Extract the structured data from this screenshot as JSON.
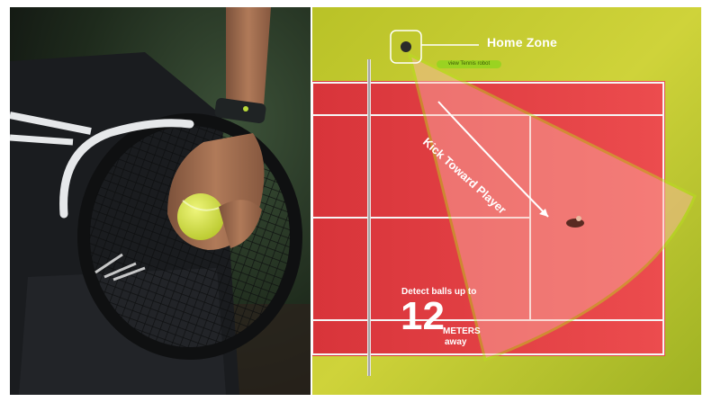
{
  "left_photo": {
    "subject": "tennis-player-holding-racket-and-ball",
    "colors": {
      "ball": "#d6e83a",
      "strings": "#1b1d1f",
      "frame": "#e6e8ea",
      "skin": "#9c6b4f",
      "band": "#1f2324"
    }
  },
  "court_graphic": {
    "home_zone_label": "Home Zone",
    "robot_tag": "view Tennis robot",
    "kick_label": "Kick Toward Player",
    "detect_text": "Detect balls up to",
    "range_value": "12",
    "range_unit": "METERS",
    "range_suffix": "away",
    "colors": {
      "court": "#e63a3f",
      "grass": "#bcc42a",
      "zone_fill": "#ffb5a9",
      "zone_outline": "#b8e21d",
      "line": "#f5f5f5"
    }
  }
}
